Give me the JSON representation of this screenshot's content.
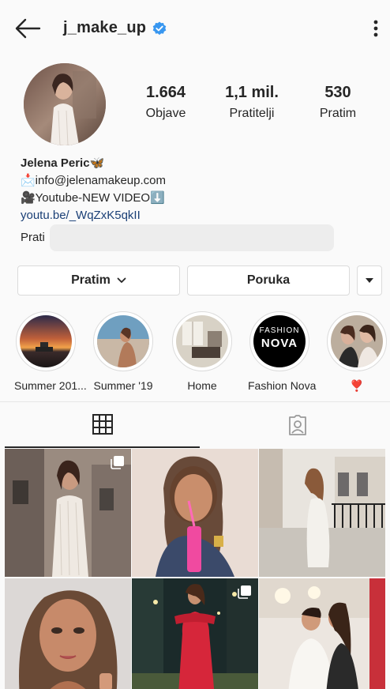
{
  "header": {
    "username": "j_make_up",
    "verified_icon": "verified-badge-icon",
    "back_icon": "arrow-left-icon",
    "more_icon": "vertical-dots-icon"
  },
  "stats": [
    {
      "value": "1.664",
      "label": "Objave"
    },
    {
      "value": "1,1 mil.",
      "label": "Pratitelji"
    },
    {
      "value": "530",
      "label": "Pratim"
    }
  ],
  "bio": {
    "name": "Jelena Peric🦋",
    "line1": "📩info@jelenamakeup.com",
    "line2": "🎥Youtube-NEW VIDEO⬇️",
    "link": "youtu.be/_WqZxK5qkII",
    "prati": "Prati"
  },
  "buttons": {
    "following": "Pratim",
    "message": "Poruka"
  },
  "highlights": [
    {
      "label": "Summer 201..."
    },
    {
      "label": "Summer '19"
    },
    {
      "label": "Home"
    },
    {
      "label": "Fashion Nova",
      "logo_text_top": "FASHION",
      "logo_text_bottom": "NOVA"
    },
    {
      "label": "❣️"
    }
  ],
  "tabs": [
    {
      "icon": "grid-icon"
    },
    {
      "icon": "tagged-icon"
    }
  ],
  "colors": {
    "accent_blue": "#3897f0",
    "link": "#1a3f76",
    "border": "#dbdbdb"
  }
}
